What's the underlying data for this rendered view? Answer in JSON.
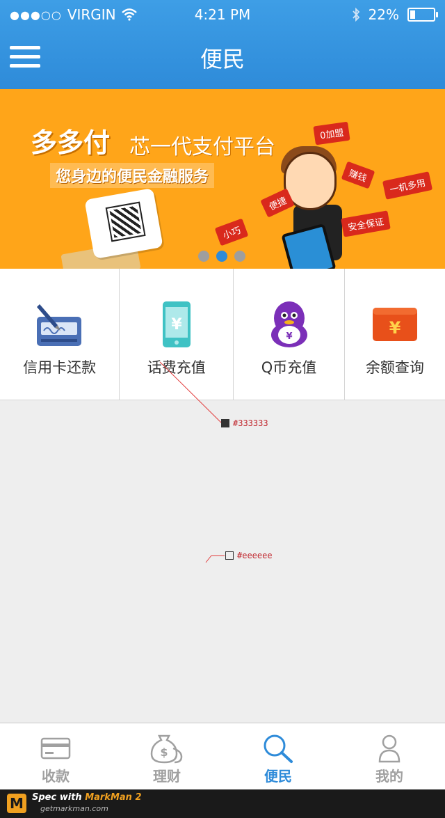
{
  "status_bar": {
    "signal_dots": "●●●○○",
    "carrier": "VIRGIN",
    "time": "4:21 PM",
    "battery_percent": "22%",
    "battery_level": 0.22
  },
  "nav": {
    "title": "便民",
    "menu_icon": "hamburger-icon"
  },
  "banner": {
    "headline": "多多付",
    "headline2": "芯一代支付平台",
    "tagline": "您身边的便民金融服务",
    "tags": [
      "0加盟",
      "赚钱",
      "一机多用",
      "便捷",
      "安全保证",
      "小巧"
    ],
    "pager": {
      "count": 3,
      "active_index": 1
    }
  },
  "services": [
    {
      "label": "信用卡还款",
      "icon": "credit-card-pen-icon"
    },
    {
      "label": "话费充值",
      "icon": "phone-yen-icon"
    },
    {
      "label": "Q币充值",
      "icon": "qq-penguin-icon"
    },
    {
      "label": "余额查询",
      "icon": "wallet-yen-icon"
    }
  ],
  "annotations": [
    {
      "text": "#333333",
      "color": "#333333"
    },
    {
      "text": "#eeeeee",
      "color": "#eeeeee"
    }
  ],
  "tabbar": {
    "tabs": [
      {
        "label": "收款",
        "icon": "card-icon"
      },
      {
        "label": "理财",
        "icon": "money-bag-icon"
      },
      {
        "label": "便民",
        "icon": "search-icon"
      },
      {
        "label": "我的",
        "icon": "user-icon"
      }
    ],
    "active_index": 2
  },
  "footer": {
    "prefix": "Spec with ",
    "brand": "MarkMan 2",
    "url": "getmarkman.com"
  },
  "colors": {
    "accent": "#2e8bd9",
    "text": "#333333",
    "background": "#eeeeee",
    "banner": "#ffa519"
  }
}
